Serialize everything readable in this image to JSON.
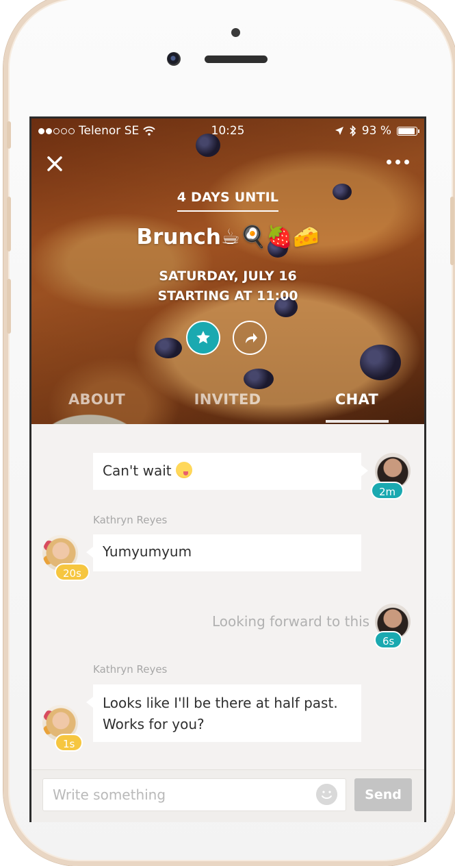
{
  "status_bar": {
    "carrier": "Telenor SE",
    "time": "10:25",
    "battery": "93 %",
    "icons": [
      "signal-dots-icon",
      "wifi-icon",
      "location-arrow-icon",
      "bluetooth-icon",
      "battery-icon"
    ]
  },
  "header": {
    "close_icon": "close-icon",
    "more_icon": "more-dots-icon",
    "countdown": "4 DAYS UNTIL",
    "title": "Brunch☕🍳🍓🧀",
    "date_line": "SATURDAY, JULY 16",
    "time_line": "STARTING AT 11:00",
    "star_icon": "star-icon",
    "share_icon": "share-arrow-icon"
  },
  "tabs": [
    {
      "label": "ABOUT",
      "active": false
    },
    {
      "label": "INVITED",
      "active": false
    },
    {
      "label": "CHAT",
      "active": true
    }
  ],
  "messages": [
    {
      "from": "me",
      "text": "Can't wait",
      "emoji": "yum-face-emoji",
      "time": "2m"
    },
    {
      "from": "Kathryn Reyes",
      "sender_label": "Kathryn Reyes",
      "text": "Yumyumyum",
      "time": "20s"
    },
    {
      "from": "me",
      "text": "Looking forward to this",
      "time": "6s",
      "pending": true
    },
    {
      "from": "Kathryn Reyes",
      "sender_label": "Kathryn Reyes",
      "text_line1": "Looks like I'll be there at half past.",
      "text_line2": "Works for you?",
      "time": "1s"
    }
  ],
  "composer": {
    "placeholder": "Write something",
    "emoji_icon": "smiley-icon",
    "send_label": "Send"
  },
  "colors": {
    "accent_teal": "#1aa9b0",
    "badge_yellow": "#f6c640",
    "send_disabled": "#c4c4c4"
  }
}
